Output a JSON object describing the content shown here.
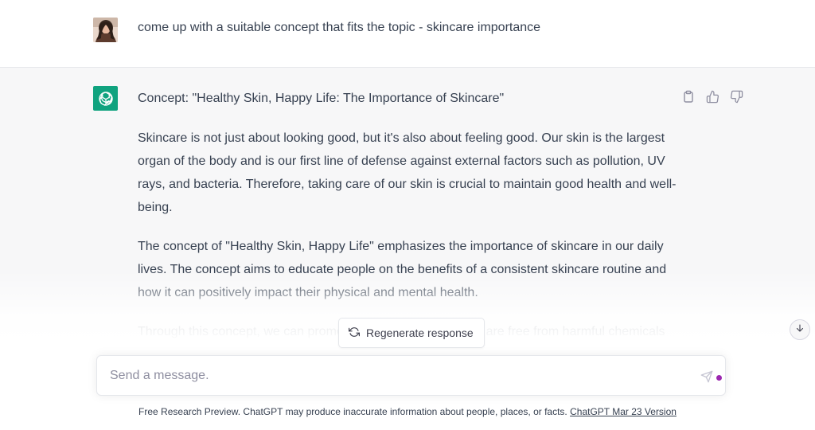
{
  "user_message": {
    "text": "come up with a suitable concept that fits the topic - skincare importance"
  },
  "assistant_message": {
    "concept": "Concept: \"Healthy Skin, Happy Life: The Importance of Skincare\"",
    "paragraphs": [
      "Skincare is not just about looking good, but it's also about feeling good. Our skin is the largest organ of the body and is our first line of defense against external factors such as pollution, UV rays, and bacteria. Therefore, taking care of our skin is crucial to maintain good health and well-being.",
      "The concept of \"Healthy Skin, Happy Life\" emphasizes the importance of skincare in our daily lives. The concept aims to educate people on the benefits of a consistent skincare routine and how it can positively impact their physical and mental health.",
      "Through this concept, we can promote skincare products that are free from harmful chemicals and use natural ingredients that benefit the skin. We can also raise"
    ]
  },
  "controls": {
    "regenerate_label": "Regenerate response",
    "input_placeholder": "Send a message."
  },
  "footer": {
    "text": "Free Research Preview. ChatGPT may produce inaccurate information about people, places, or facts.",
    "link": "ChatGPT Mar 23 Version"
  },
  "colors": {
    "brand_green": "#10a37f",
    "panel_bg": "#f7f7f8",
    "text": "#374151",
    "status_dot": "#9c27b0"
  },
  "icons": [
    "user-avatar",
    "openai-logo-icon",
    "copy-icon",
    "thumbs-up-icon",
    "thumbs-down-icon",
    "refresh-icon",
    "arrow-down-icon",
    "send-icon"
  ]
}
